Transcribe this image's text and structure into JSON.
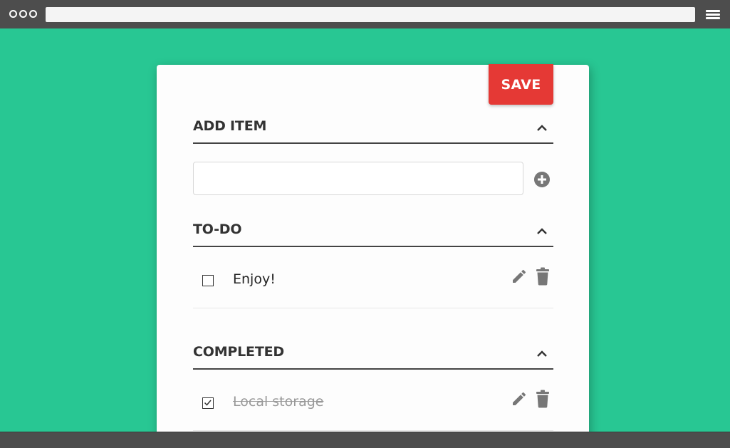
{
  "browser": {
    "icons": [
      "window-dots-icon",
      "hamburger-menu-icon"
    ]
  },
  "toolbar": {
    "save_label": "SAVE"
  },
  "sections": {
    "add": {
      "title": "ADD ITEM",
      "input_value": "",
      "input_placeholder": ""
    },
    "todo": {
      "title": "TO-DO",
      "items": [
        {
          "label": "Enjoy!",
          "checked": false
        }
      ]
    },
    "completed": {
      "title": "COMPLETED",
      "items": [
        {
          "label": "Local storage",
          "checked": true
        }
      ]
    }
  },
  "colors": {
    "background": "#28c793",
    "save_button": "#e53935",
    "chrome": "#4d4d4d",
    "icon_gray": "#777777"
  }
}
